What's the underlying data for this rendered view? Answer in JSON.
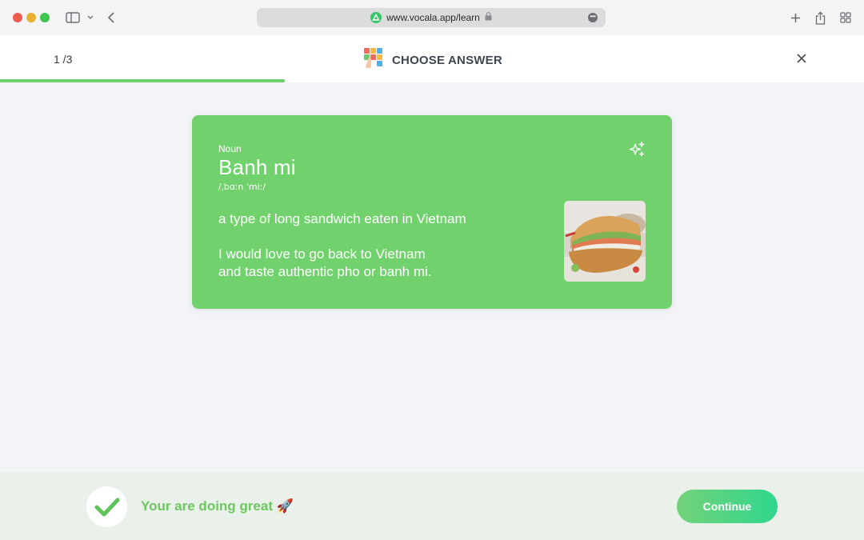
{
  "browser": {
    "url": "www.vocala.app/learn"
  },
  "header": {
    "counter": "1 /3",
    "title": "CHOOSE ANSWER",
    "progress": 0.33
  },
  "card": {
    "part_of_speech": "Noun",
    "word": "Banh mi",
    "pronunciation": "/ˌbɑːn ˈmiː/",
    "definition": "a type of long sandwich eaten in Vietnam",
    "example_line1": "I would love to go back to Vietnam",
    "example_line2": "and taste authentic pho or banh mi.",
    "image_icon": "banh-mi-photo"
  },
  "footer": {
    "feedback": "Your are doing great 🚀",
    "continue_label": "Continue"
  },
  "colors": {
    "card_green": "#71d26d",
    "accent_green": "#6fcf6a",
    "footer_bg": "#e9f1ea"
  }
}
